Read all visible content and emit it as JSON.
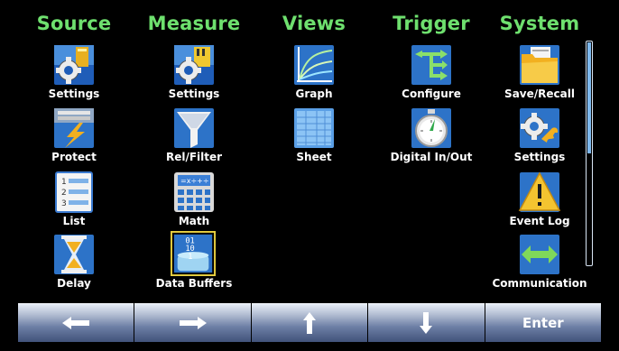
{
  "columns": [
    {
      "header": "Source",
      "items": [
        "Settings",
        "Protect",
        "List",
        "Delay"
      ]
    },
    {
      "header": "Measure",
      "items": [
        "Settings",
        "Rel/Filter",
        "Math",
        "Data Buffers"
      ]
    },
    {
      "header": "Views",
      "items": [
        "Graph",
        "Sheet"
      ]
    },
    {
      "header": "Trigger",
      "items": [
        "Configure",
        "Digital In/Out"
      ]
    },
    {
      "header": "System",
      "items": [
        "Save/Recall",
        "Settings",
        "Event Log",
        "Communication"
      ]
    }
  ],
  "bottom_bar": {
    "left_icon": "left-arrow-icon",
    "right_icon": "right-arrow-icon",
    "up_icon": "up-arrow-icon",
    "down_icon": "down-arrow-icon",
    "enter_label": "Enter"
  },
  "colors": {
    "header": "#6ee06e",
    "background": "#000000",
    "selected_border": "#e8d040"
  },
  "scrollbar": {
    "position_fraction": 0.0,
    "visible_fraction": 0.5
  }
}
